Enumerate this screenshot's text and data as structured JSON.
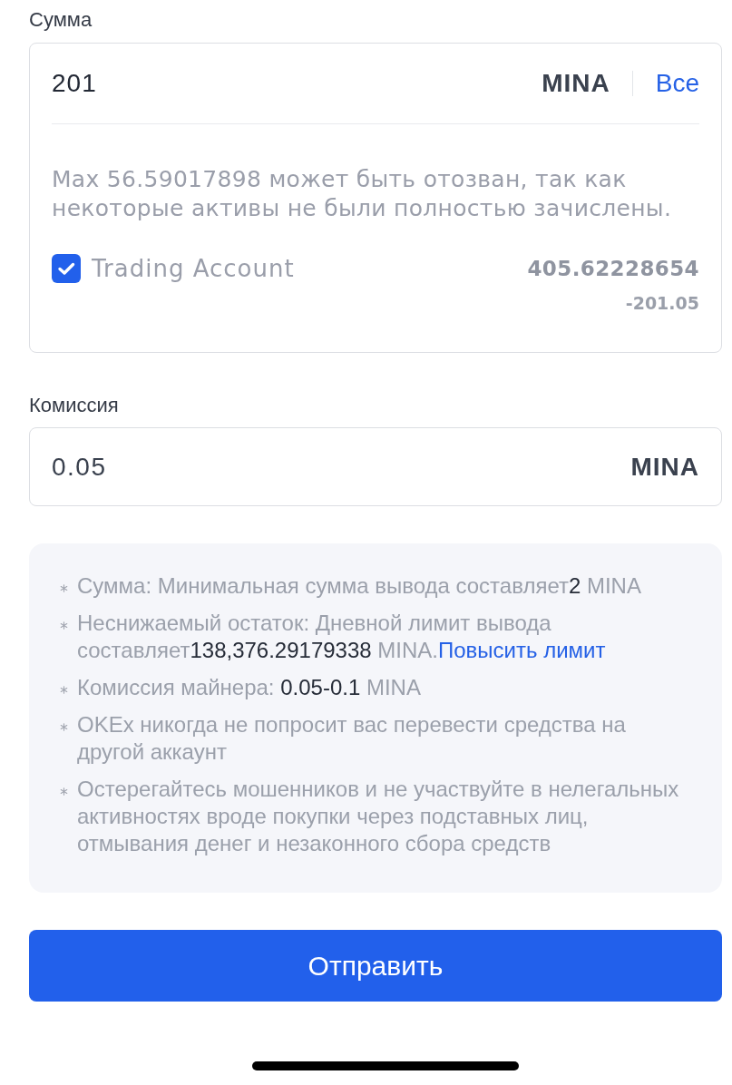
{
  "amount": {
    "label": "Сумма",
    "value": "201",
    "unit": "MINA",
    "all_button": "Все",
    "note": "Max 56.59017898 может быть отозван, так как некоторые активы не были полностью зачислены.",
    "account": {
      "label": "Trading Account",
      "checked": true,
      "balance": "405.62228654",
      "change": "-201.05"
    }
  },
  "fee": {
    "label": "Комиссия",
    "value": "0.05",
    "unit": "MINA"
  },
  "notices": [
    {
      "text": "Сумма: Минимальная сумма вывода составляет**2** MINA"
    },
    {
      "text": "Неснижаемый остаток: Дневной лимит вывода составляет**138,376.29179338** MINA.",
      "link": "Повысить лимит"
    },
    {
      "text": "Комиссия майнера: **0.05-0.1** MINA"
    },
    {
      "text": "OKEx никогда не попросит вас перевести средства на другой аккаунт"
    },
    {
      "text": "Остерегайтесь мошенников и не участвуйте в нелегальных активностях вроде покупки через подставных лиц, отмывания денег и незаконного сбора средств"
    }
  ],
  "submit_button": "Отправить"
}
